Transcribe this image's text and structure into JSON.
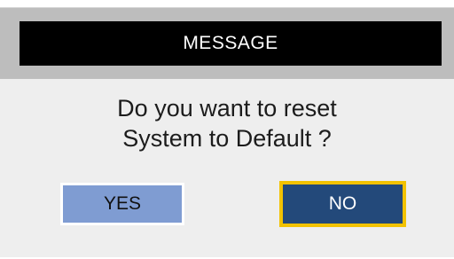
{
  "dialog": {
    "title": "MESSAGE",
    "message_line1": "Do you want to reset",
    "message_line2": "System to Default ?",
    "buttons": {
      "yes_label": "YES",
      "no_label": "NO"
    },
    "focused_button": "NO"
  },
  "colors": {
    "title_strip": "#000000",
    "title_frame": "#bdbdbd",
    "panel_bg": "#eeeeee",
    "yes_bg": "#7f9cd2",
    "no_bg": "#23497a",
    "focus_border": "#f2c200"
  }
}
